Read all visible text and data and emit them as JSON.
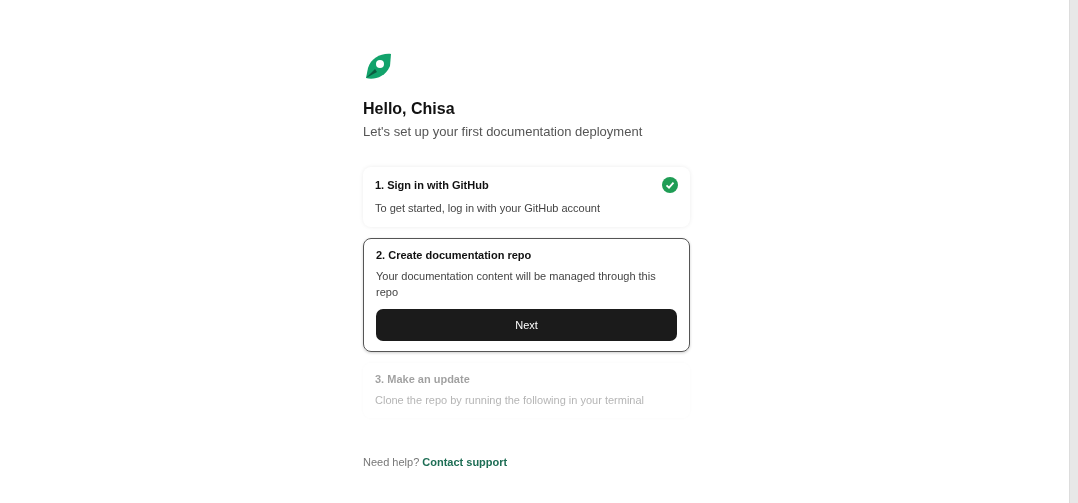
{
  "greeting": "Hello, Chisa",
  "subtitle": "Let's set up your first documentation deployment",
  "steps": [
    {
      "title": "1. Sign in with GitHub",
      "description": "To get started, log in with your GitHub account",
      "completed": true,
      "selected": false,
      "disabled": false
    },
    {
      "title": "2. Create documentation repo",
      "description": "Your documentation content will be managed through this repo",
      "completed": false,
      "selected": true,
      "disabled": false,
      "button": "Next"
    },
    {
      "title": "3. Make an update",
      "description": "Clone the repo by running the following in your terminal",
      "completed": false,
      "selected": false,
      "disabled": true
    }
  ],
  "help": {
    "text": "Need help?",
    "link": "Contact support"
  }
}
